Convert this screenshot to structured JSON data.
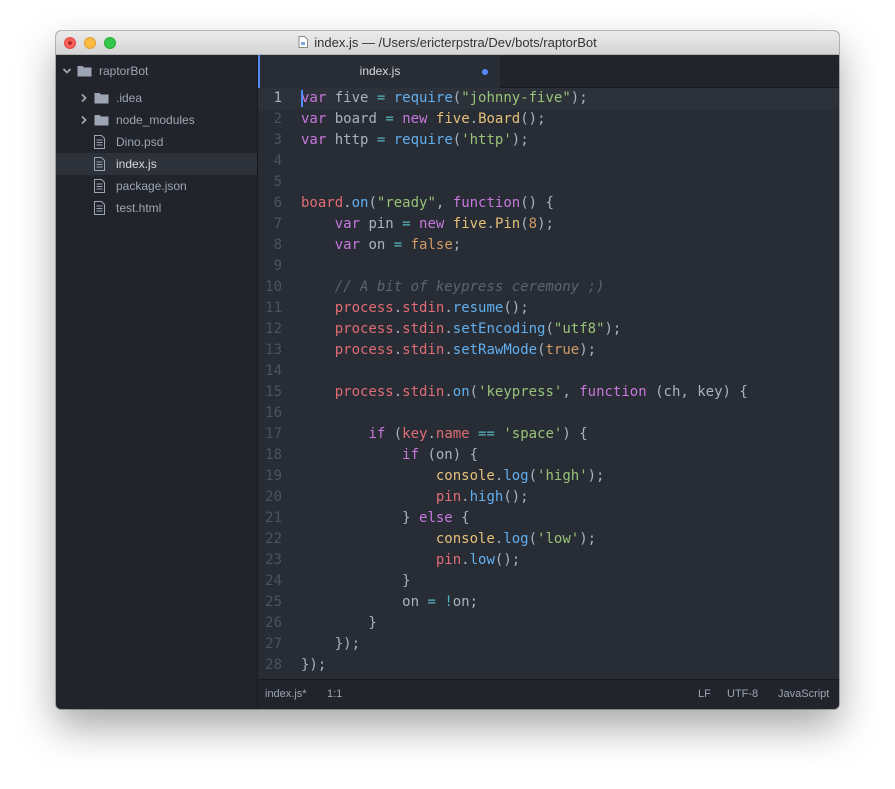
{
  "window": {
    "title": "index.js — /Users/ericterpstra/Dev/bots/raptorBot"
  },
  "sidebar": {
    "root": {
      "label": "raptorBot",
      "icon": "folder-icon"
    },
    "items": [
      {
        "label": ".idea",
        "type": "folder",
        "icon": "folder-icon"
      },
      {
        "label": "node_modules",
        "type": "folder",
        "icon": "folder-icon"
      },
      {
        "label": "Dino.psd",
        "type": "file",
        "icon": "file-icon"
      },
      {
        "label": "index.js",
        "type": "file",
        "icon": "file-icon",
        "selected": true
      },
      {
        "label": "package.json",
        "type": "file",
        "icon": "file-icon"
      },
      {
        "label": "test.html",
        "type": "file",
        "icon": "file-icon"
      }
    ]
  },
  "tabs": [
    {
      "label": "index.js",
      "modified": true,
      "active": true
    }
  ],
  "editor": {
    "cursor_line": 1,
    "lines": [
      [
        [
          "kw",
          "var"
        ],
        [
          "pl",
          " five "
        ],
        [
          "op",
          "="
        ],
        [
          "pl",
          " "
        ],
        [
          "fn",
          "require"
        ],
        [
          "pl",
          "("
        ],
        [
          "str",
          "\"johnny-five\""
        ],
        [
          "pl",
          ");"
        ]
      ],
      [
        [
          "kw",
          "var"
        ],
        [
          "pl",
          " board "
        ],
        [
          "op",
          "="
        ],
        [
          "pl",
          " "
        ],
        [
          "kw",
          "new"
        ],
        [
          "pl",
          " "
        ],
        [
          "cls",
          "five"
        ],
        [
          "pl",
          "."
        ],
        [
          "cls",
          "Board"
        ],
        [
          "pl",
          "();"
        ]
      ],
      [
        [
          "kw",
          "var"
        ],
        [
          "pl",
          " http "
        ],
        [
          "op",
          "="
        ],
        [
          "pl",
          " "
        ],
        [
          "fn",
          "require"
        ],
        [
          "pl",
          "("
        ],
        [
          "str",
          "'http'"
        ],
        [
          "pl",
          ");"
        ]
      ],
      [],
      [],
      [
        [
          "var",
          "board"
        ],
        [
          "pl",
          "."
        ],
        [
          "fn",
          "on"
        ],
        [
          "pl",
          "("
        ],
        [
          "str",
          "\"ready\""
        ],
        [
          "pl",
          ", "
        ],
        [
          "kw",
          "function"
        ],
        [
          "pl",
          "() {"
        ]
      ],
      [
        [
          "pl",
          "    "
        ],
        [
          "kw",
          "var"
        ],
        [
          "pl",
          " pin "
        ],
        [
          "op",
          "="
        ],
        [
          "pl",
          " "
        ],
        [
          "kw",
          "new"
        ],
        [
          "pl",
          " "
        ],
        [
          "cls",
          "five"
        ],
        [
          "pl",
          "."
        ],
        [
          "cls",
          "Pin"
        ],
        [
          "pl",
          "("
        ],
        [
          "num",
          "8"
        ],
        [
          "pl",
          ");"
        ]
      ],
      [
        [
          "pl",
          "    "
        ],
        [
          "kw",
          "var"
        ],
        [
          "pl",
          " on "
        ],
        [
          "op",
          "="
        ],
        [
          "pl",
          " "
        ],
        [
          "num",
          "false"
        ],
        [
          "pl",
          ";"
        ]
      ],
      [],
      [
        [
          "pl",
          "    "
        ],
        [
          "cm",
          "// A bit of keypress ceremony ;)"
        ]
      ],
      [
        [
          "pl",
          "    "
        ],
        [
          "var",
          "process"
        ],
        [
          "pl",
          "."
        ],
        [
          "var",
          "stdin"
        ],
        [
          "pl",
          "."
        ],
        [
          "fn",
          "resume"
        ],
        [
          "pl",
          "();"
        ]
      ],
      [
        [
          "pl",
          "    "
        ],
        [
          "var",
          "process"
        ],
        [
          "pl",
          "."
        ],
        [
          "var",
          "stdin"
        ],
        [
          "pl",
          "."
        ],
        [
          "fn",
          "setEncoding"
        ],
        [
          "pl",
          "("
        ],
        [
          "str",
          "\"utf8\""
        ],
        [
          "pl",
          ");"
        ]
      ],
      [
        [
          "pl",
          "    "
        ],
        [
          "var",
          "process"
        ],
        [
          "pl",
          "."
        ],
        [
          "var",
          "stdin"
        ],
        [
          "pl",
          "."
        ],
        [
          "fn",
          "setRawMode"
        ],
        [
          "pl",
          "("
        ],
        [
          "num",
          "true"
        ],
        [
          "pl",
          ");"
        ]
      ],
      [],
      [
        [
          "pl",
          "    "
        ],
        [
          "var",
          "process"
        ],
        [
          "pl",
          "."
        ],
        [
          "var",
          "stdin"
        ],
        [
          "pl",
          "."
        ],
        [
          "fn",
          "on"
        ],
        [
          "pl",
          "("
        ],
        [
          "str",
          "'keypress'"
        ],
        [
          "pl",
          ", "
        ],
        [
          "kw",
          "function"
        ],
        [
          "pl",
          " (ch, key) {"
        ]
      ],
      [],
      [
        [
          "pl",
          "        "
        ],
        [
          "kw",
          "if"
        ],
        [
          "pl",
          " ("
        ],
        [
          "var",
          "key"
        ],
        [
          "pl",
          "."
        ],
        [
          "var",
          "name"
        ],
        [
          "pl",
          " "
        ],
        [
          "op",
          "=="
        ],
        [
          "pl",
          " "
        ],
        [
          "str",
          "'space'"
        ],
        [
          "pl",
          ") {"
        ]
      ],
      [
        [
          "pl",
          "            "
        ],
        [
          "kw",
          "if"
        ],
        [
          "pl",
          " (on) {"
        ]
      ],
      [
        [
          "pl",
          "                "
        ],
        [
          "cls",
          "console"
        ],
        [
          "pl",
          "."
        ],
        [
          "fn",
          "log"
        ],
        [
          "pl",
          "("
        ],
        [
          "str",
          "'high'"
        ],
        [
          "pl",
          ");"
        ]
      ],
      [
        [
          "pl",
          "                "
        ],
        [
          "var",
          "pin"
        ],
        [
          "pl",
          "."
        ],
        [
          "fn",
          "high"
        ],
        [
          "pl",
          "();"
        ]
      ],
      [
        [
          "pl",
          "            } "
        ],
        [
          "kw",
          "else"
        ],
        [
          "pl",
          " {"
        ]
      ],
      [
        [
          "pl",
          "                "
        ],
        [
          "cls",
          "console"
        ],
        [
          "pl",
          "."
        ],
        [
          "fn",
          "log"
        ],
        [
          "pl",
          "("
        ],
        [
          "str",
          "'low'"
        ],
        [
          "pl",
          ");"
        ]
      ],
      [
        [
          "pl",
          "                "
        ],
        [
          "var",
          "pin"
        ],
        [
          "pl",
          "."
        ],
        [
          "fn",
          "low"
        ],
        [
          "pl",
          "();"
        ]
      ],
      [
        [
          "pl",
          "            }"
        ]
      ],
      [
        [
          "pl",
          "            on "
        ],
        [
          "op",
          "="
        ],
        [
          "pl",
          " "
        ],
        [
          "op",
          "!"
        ],
        [
          "pl",
          "on;"
        ]
      ],
      [
        [
          "pl",
          "        }"
        ]
      ],
      [
        [
          "pl",
          "    });"
        ]
      ],
      [
        [
          "pl",
          "});"
        ]
      ]
    ]
  },
  "statusbar": {
    "file": "index.js*",
    "position": "1:1",
    "line_ending": "LF",
    "encoding": "UTF-8",
    "grammar": "JavaScript"
  },
  "colors": {
    "accent": "#568af2",
    "keyword": "#c678dd",
    "string": "#98c379",
    "function": "#61afef",
    "variable": "#e06c75",
    "class": "#e5c07b",
    "number": "#d19a66",
    "comment": "#5c6370"
  }
}
